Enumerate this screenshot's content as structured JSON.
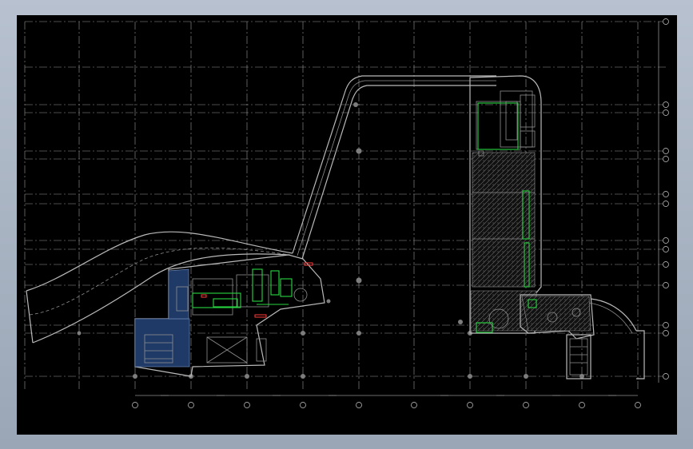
{
  "viewer": {
    "background": "#000000",
    "frame_color": "#a8b3c2"
  },
  "drawing": {
    "colors": {
      "grid": "#9a9a9a",
      "walls": "#b9b9b9",
      "highlight_green": "#27d640",
      "highlight_red": "#ff3a3a",
      "blue_zone": "#1f3a66"
    }
  }
}
